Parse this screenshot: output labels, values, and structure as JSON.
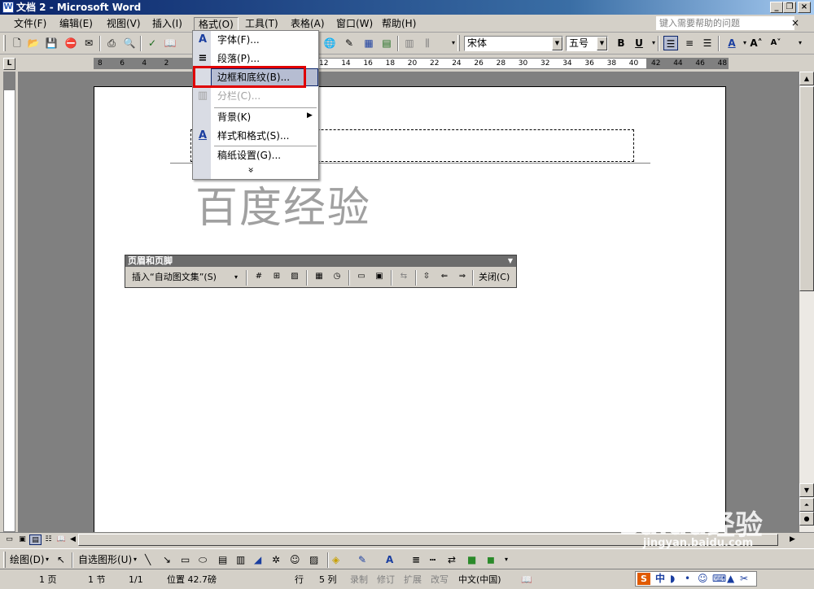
{
  "window": {
    "title": "文档 2 - Microsoft Word",
    "app_icon": "W"
  },
  "menu": {
    "items": [
      "文件(F)",
      "编辑(E)",
      "视图(V)",
      "插入(I)",
      "格式(O)",
      "工具(T)",
      "表格(A)",
      "窗口(W)",
      "帮助(H)"
    ],
    "help_placeholder": "键入需要帮助的问题",
    "close_glyph": "×"
  },
  "toolbar": {
    "font_name": "宋体",
    "font_size": "五号",
    "bold": "B",
    "underline": "U",
    "font_color_label": "A"
  },
  "ruler": {
    "marks": [
      "8",
      "6",
      "4",
      "2",
      "",
      "",
      "",
      "",
      "",
      "",
      "12",
      "14",
      "16",
      "18",
      "20",
      "22",
      "24",
      "26",
      "28",
      "30",
      "32",
      "34",
      "36",
      "38",
      "40",
      "42",
      "44",
      "46",
      "48"
    ],
    "tab_selector": "L"
  },
  "format_menu": {
    "items": [
      {
        "label": "字体(F)...",
        "icon": "A",
        "disabled": false
      },
      {
        "label": "段落(P)...",
        "icon": "≡",
        "disabled": false
      },
      {
        "label": "边框和底纹(B)...",
        "icon": "",
        "disabled": false,
        "highlighted": true
      },
      {
        "label": "分栏(C)...",
        "icon": "▥",
        "disabled": true
      },
      {
        "label": "背景(K)",
        "icon": "",
        "disabled": false,
        "submenu": true
      },
      {
        "label": "样式和格式(S)...",
        "icon": "A",
        "disabled": false
      },
      {
        "label": "稿纸设置(G)...",
        "icon": "",
        "disabled": false
      }
    ],
    "expand_glyph": "»"
  },
  "document": {
    "body_text": "百度经验"
  },
  "header_footer_toolbar": {
    "title": "页眉和页脚",
    "insert_autotext": "插入“自动图文集”(S)",
    "close": "关闭(C)"
  },
  "drawing_toolbar": {
    "draw": "绘图(D)",
    "autoshapes": "自选图形(U)"
  },
  "status": {
    "page": "1 页",
    "section": "1 节",
    "page_of": "1/1",
    "position": "位置 42.7磅",
    "line": "行",
    "column": "5 列",
    "rec": "录制",
    "trk": "修订",
    "ext": "扩展",
    "ovr": "改写",
    "language": "中文(中国)",
    "ime": "中"
  },
  "watermark": {
    "brand": "Baidu经验",
    "url": "jingyan.baidu.com"
  },
  "colors": {
    "titlebar": "#0a246a",
    "highlight": "#b6bdd2",
    "red_box": "#e00000"
  }
}
